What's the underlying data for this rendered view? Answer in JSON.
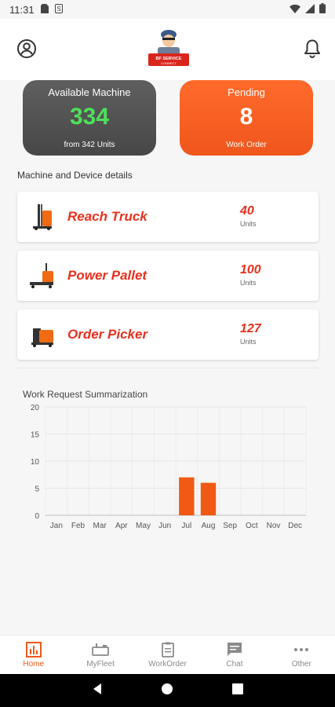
{
  "status_bar": {
    "time": "11:31"
  },
  "header": {
    "logo_text": "BF SERVICE CONNECT"
  },
  "cards": {
    "available": {
      "title": "Available Machine",
      "value": "334",
      "sub": "from 342 Units"
    },
    "pending": {
      "title": "Pending",
      "value": "8",
      "sub": "Work Order"
    }
  },
  "machines": {
    "section_label": "Machine and Device details",
    "items": [
      {
        "name": "Reach Truck",
        "count": "40",
        "unit": "Units"
      },
      {
        "name": "Power Pallet",
        "count": "100",
        "unit": "Units"
      },
      {
        "name": "Order Picker",
        "count": "127",
        "unit": "Units"
      }
    ]
  },
  "colors": {
    "accent": "#ef5a1c",
    "name_red": "#e8301e",
    "available_green": "#4fe05b"
  },
  "chart_data": {
    "type": "bar",
    "title": "Work Request Summarization",
    "categories": [
      "Jan",
      "Feb",
      "Mar",
      "Apr",
      "May",
      "Jun",
      "Jul",
      "Aug",
      "Sep",
      "Oct",
      "Nov",
      "Dec"
    ],
    "values": [
      0,
      0,
      0,
      0,
      0,
      0,
      7,
      6,
      0,
      0,
      0,
      0
    ],
    "ylim": [
      0,
      20
    ],
    "yticks": [
      0,
      5,
      10,
      15,
      20
    ],
    "grid": true,
    "bar_color": "#f05a14"
  },
  "bottom_nav": [
    {
      "label": "Home",
      "icon": "home-chart-icon",
      "active": true
    },
    {
      "label": "MyFleet",
      "icon": "fleet-icon",
      "active": false
    },
    {
      "label": "WorkOrder",
      "icon": "clipboard-icon",
      "active": false
    },
    {
      "label": "Chat",
      "icon": "chat-icon",
      "active": false
    },
    {
      "label": "Other",
      "icon": "more-icon",
      "active": false
    }
  ]
}
